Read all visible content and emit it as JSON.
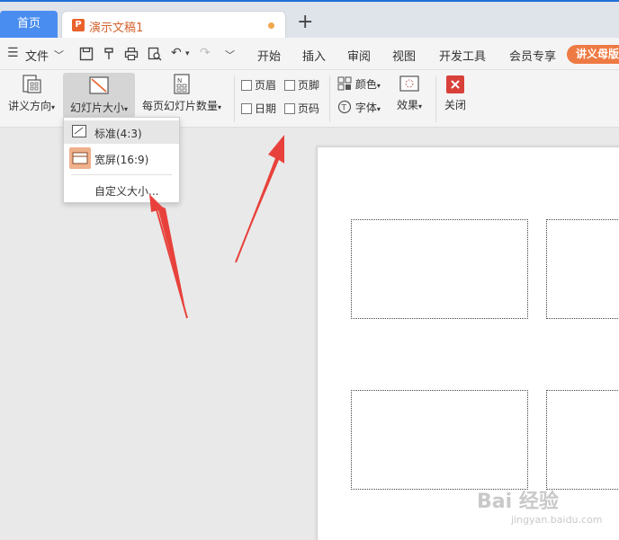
{
  "tabs": {
    "home": "首页",
    "doc_title": "演示文稿1",
    "add": "+"
  },
  "menu": {
    "file": "文件",
    "items": [
      "开始",
      "插入",
      "审阅",
      "视图",
      "开发工具",
      "会员专享"
    ],
    "vip_tab": "讲义母版"
  },
  "ribbon": {
    "handout_orientation": "讲义方向",
    "slide_size": "幻灯片大小",
    "slides_per_page": "每页幻灯片数量",
    "header": "页眉",
    "footer": "页脚",
    "date": "日期",
    "page_number": "页码",
    "color": "颜色",
    "font": "字体",
    "effects": "效果",
    "close": "关闭"
  },
  "slide_size_menu": {
    "standard": "标准(4:3)",
    "widescreen": "宽屏(16:9)",
    "custom": "自定义大小..."
  },
  "watermark": {
    "brand": "Bai 经验",
    "site": "jingyan.baidu.com"
  },
  "colors": {
    "accent_blue": "#4a8df0",
    "brand_orange": "#ee7a43",
    "arrow_red": "#e8413b"
  }
}
